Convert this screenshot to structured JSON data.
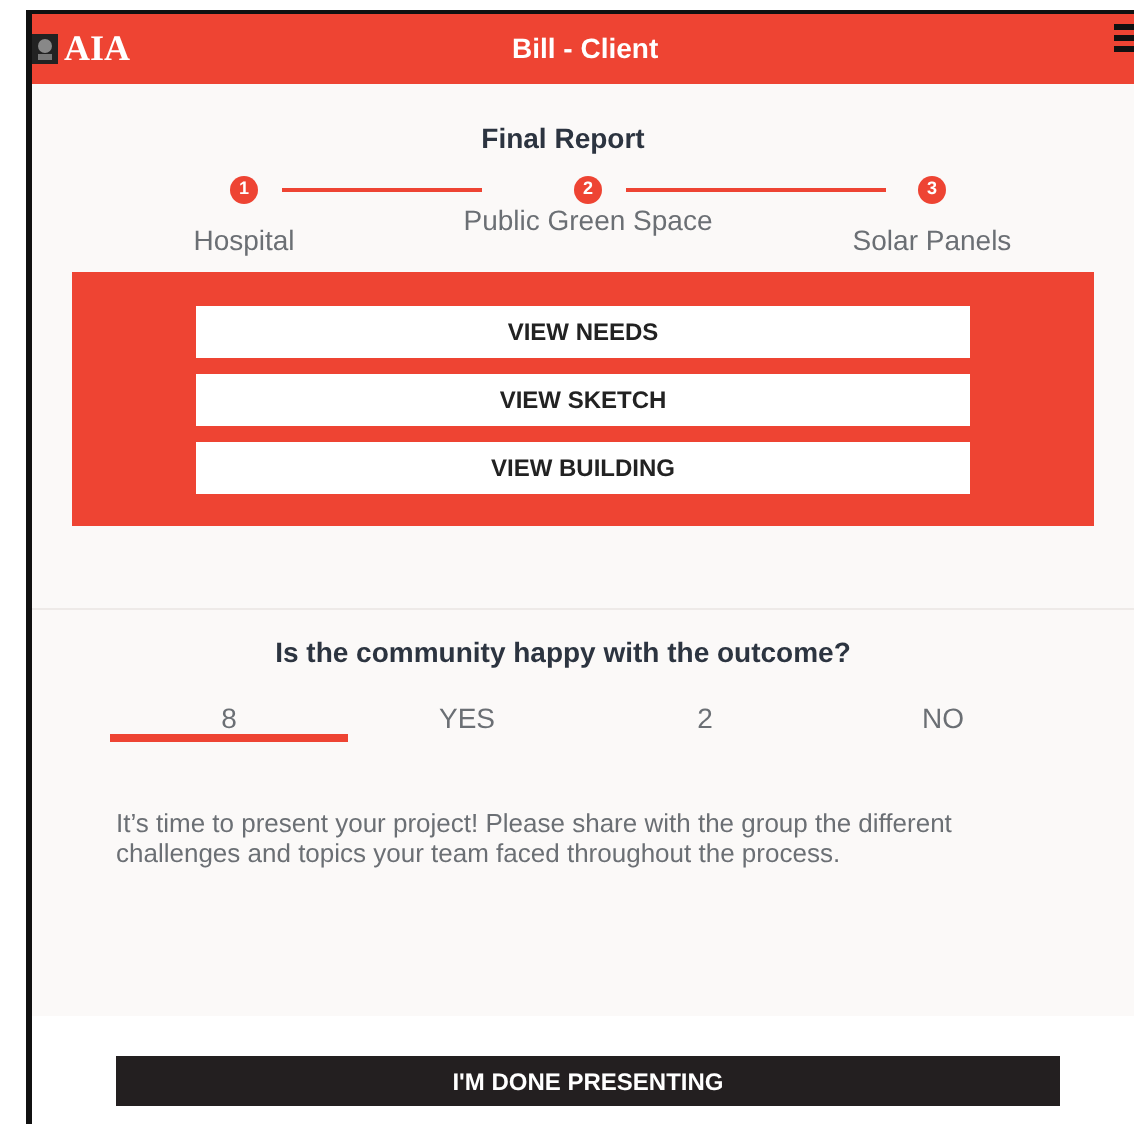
{
  "header": {
    "logo": "AIA",
    "title": "Bill - Client"
  },
  "report": {
    "title": "Final Report",
    "steps": [
      {
        "number": "1",
        "label": "Hospital"
      },
      {
        "number": "2",
        "label": "Public Green Space"
      },
      {
        "number": "3",
        "label": "Solar Panels"
      }
    ],
    "buttons": [
      "VIEW NEEDS",
      "VIEW SKETCH",
      "VIEW BUILDING"
    ]
  },
  "question": {
    "text": "Is the community happy with the outcome?",
    "options": [
      {
        "label": "8",
        "selected": true
      },
      {
        "label": "YES",
        "selected": false
      },
      {
        "label": "2",
        "selected": false
      },
      {
        "label": "NO",
        "selected": false
      }
    ]
  },
  "message": "It’s time to present your project! Please share with the group the different challenges and topics your team faced throughout the process.",
  "done_button": "I'M DONE PRESENTING"
}
